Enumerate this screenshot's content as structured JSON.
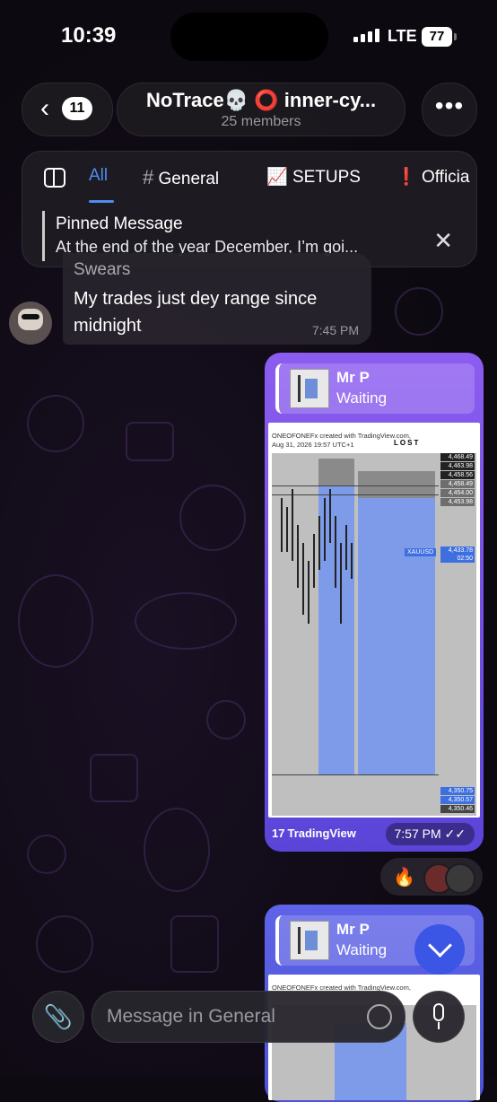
{
  "status": {
    "time": "10:39",
    "network": "LTE",
    "battery": "77"
  },
  "header": {
    "back_count": "11",
    "title": "NoTrace💀 ⭕ inner-cy...",
    "subtitle": "25 members",
    "more_label": "•••"
  },
  "topics": {
    "tabs": [
      {
        "label": "All",
        "icon": ""
      },
      {
        "label": "General",
        "icon": "#"
      },
      {
        "label": "SETUPS",
        "icon": "📈"
      },
      {
        "label": "Officia",
        "icon": "❗"
      }
    ],
    "active": "All"
  },
  "pinned": {
    "title": "Pinned Message",
    "message": "At the end of the year December, I’m goi..."
  },
  "messages": {
    "incoming": {
      "sender_partial": "Swears",
      "text": "My trades just dey range since midnight",
      "time": "7:45 PM"
    },
    "outgoing1": {
      "reply_name": "Mr P",
      "reply_text": "Waiting",
      "caption_line1": "ONEOFONEFx created with TradingView.com,",
      "caption_line2": "Aug 31, 2026 19:57 UTC+1",
      "lost_label": "LOST",
      "symbol": "XAUUSD",
      "symbol_price": "4,433.78",
      "symbol_countdown": "02:50",
      "prices_top": [
        "4,468.49",
        "4,463.98",
        "4,458.56",
        "4,458.49",
        "4,454.00",
        "4,453.98"
      ],
      "prices_bottom": [
        "4,350.75",
        "4,350.57",
        "4,350.46"
      ],
      "source": "TradingView",
      "time": "7:57 PM",
      "read_status": "✓✓"
    },
    "outgoing2": {
      "reply_name": "Mr P",
      "reply_text": "Waiting",
      "caption_line1": "ONEOFONEFx created with TradingView.com,"
    }
  },
  "reactions": {
    "emoji": "🔥"
  },
  "composer": {
    "placeholder": "Message in General"
  },
  "colors": {
    "accent": "#4d8cf5",
    "bubble_out": "#7a52e8",
    "scroll_btn": "#3b55e4"
  }
}
